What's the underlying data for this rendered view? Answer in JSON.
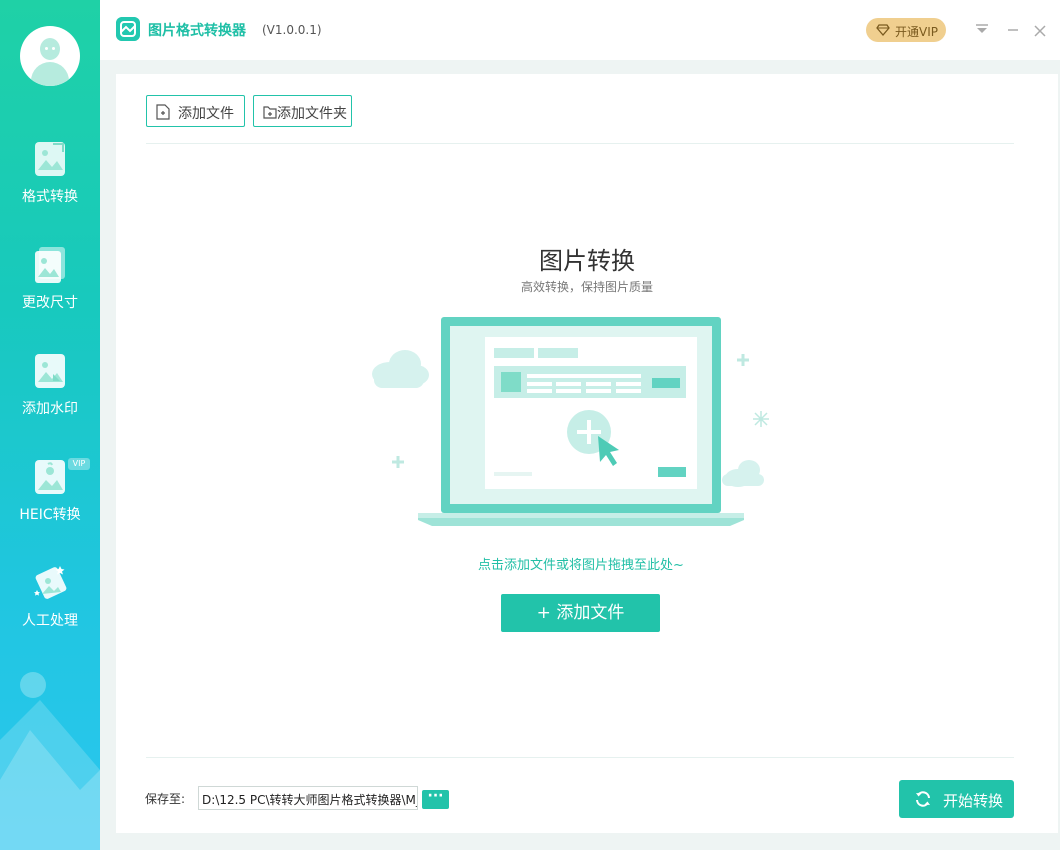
{
  "app": {
    "title": "图片格式转换器",
    "version": "(V1.0.0.1)",
    "vip_label": "开通VIP"
  },
  "sidebar": {
    "items": [
      {
        "label": "格式转换",
        "icon": "image-convert-icon"
      },
      {
        "label": "更改尺寸",
        "icon": "image-resize-icon"
      },
      {
        "label": "添加水印",
        "icon": "image-watermark-icon"
      },
      {
        "label": "HEIC转换",
        "icon": "heic-convert-icon",
        "badge": "VIP"
      },
      {
        "label": "人工处理",
        "icon": "manual-process-icon"
      }
    ]
  },
  "toolbar": {
    "add_file": "添加文件",
    "add_folder": "添加文件夹"
  },
  "main": {
    "title": "图片转换",
    "subtitle": "高效转换，保持图片质量",
    "hint": "点击添加文件或将图片拖拽至此处~",
    "add_button": "+ 添加文件"
  },
  "footer": {
    "save_label": "保存至:",
    "save_path": "D:\\12.5 PC\\转转大师图片格式转换器\\M_",
    "browse_label": "···",
    "start_button": "开始转换"
  },
  "colors": {
    "accent": "#22c3aa",
    "vip": "#f0cf8f"
  }
}
